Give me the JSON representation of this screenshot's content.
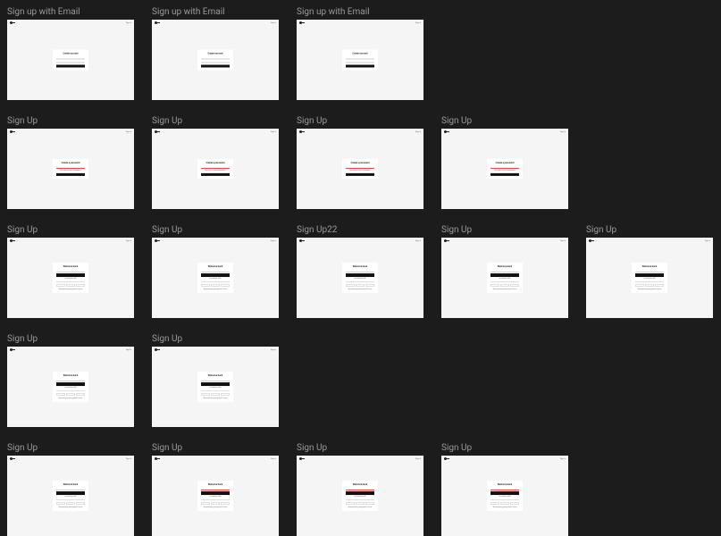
{
  "rows": [
    {
      "artboards": [
        {
          "title": "Sign up with Email",
          "variant": "signup-email-1",
          "card_heading": "Create account"
        },
        {
          "title": "Sign up with Email",
          "variant": "signup-email-2",
          "card_heading": "Create account"
        },
        {
          "title": "Sign up with Email",
          "variant": "signup-email-3",
          "card_heading": "Create account"
        }
      ]
    },
    {
      "artboards": [
        {
          "title": "Sign Up",
          "variant": "create-pw-1",
          "card_heading": "Create a password"
        },
        {
          "title": "Sign Up",
          "variant": "create-pw-2",
          "card_heading": "Create a password"
        },
        {
          "title": "Sign Up",
          "variant": "create-pw-3",
          "card_heading": "Create a password"
        },
        {
          "title": "Sign Up",
          "variant": "create-pw-4",
          "card_heading": "Create a password"
        }
      ]
    },
    {
      "artboards": [
        {
          "title": "Sign Up",
          "variant": "welcome-1",
          "card_heading": "Welcome back"
        },
        {
          "title": "Sign Up",
          "variant": "welcome-2",
          "card_heading": "Welcome back"
        },
        {
          "title": "Sign Up22",
          "variant": "welcome-3",
          "card_heading": "Welcome back"
        },
        {
          "title": "Sign Up",
          "variant": "welcome-4",
          "card_heading": "Welcome back"
        },
        {
          "title": "Sign Up",
          "variant": "welcome-5",
          "card_heading": "Welcome back"
        }
      ]
    },
    {
      "artboards": [
        {
          "title": "Sign Up",
          "variant": "welcome-6",
          "card_heading": "Welcome back"
        },
        {
          "title": "Sign Up",
          "variant": "welcome-7",
          "card_heading": "Welcome back"
        }
      ]
    },
    {
      "artboards": [
        {
          "title": "Sign Up",
          "variant": "welcome-8",
          "card_heading": "Welcome back"
        },
        {
          "title": "Sign Up",
          "variant": "welcome-9",
          "card_heading": "Welcome back"
        },
        {
          "title": "Sign Up",
          "variant": "welcome-10",
          "card_heading": "Welcome back"
        },
        {
          "title": "Sign Up",
          "variant": "welcome-11",
          "card_heading": "Welcome back"
        }
      ]
    }
  ],
  "header_right_label": "Sign in"
}
